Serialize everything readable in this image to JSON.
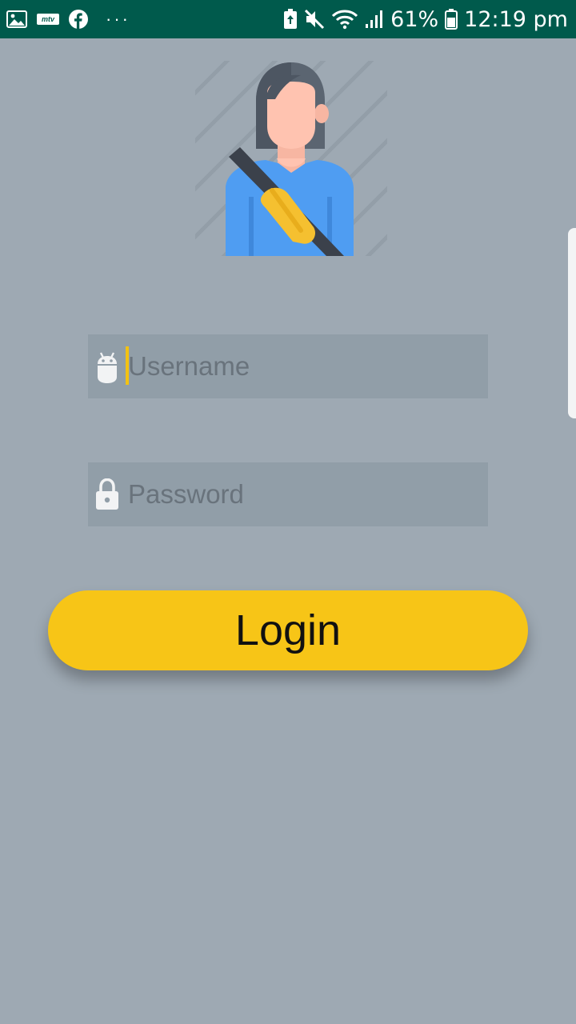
{
  "status_bar": {
    "left_icons": [
      "gallery-icon",
      "mtv-icon",
      "facebook-icon",
      "more-dots-icon"
    ],
    "mtv_label": "mtv",
    "more_label": "···",
    "battery_percent": "61%",
    "time": "12:19 pm",
    "right_icons": [
      "battery-saver-icon",
      "mute-icon",
      "wifi-icon",
      "signal-icon",
      "battery-icon"
    ]
  },
  "login_form": {
    "avatar_icon": "driver-seatbelt-avatar-icon",
    "username": {
      "icon": "android-icon",
      "placeholder": "Username",
      "value": ""
    },
    "password": {
      "icon": "lock-icon",
      "placeholder": "Password",
      "value": ""
    },
    "login_label": "Login"
  },
  "colors": {
    "status_bar": "#005a4c",
    "background": "#9ea9b3",
    "field_background": "#919ea8",
    "accent": "#f7c517"
  }
}
